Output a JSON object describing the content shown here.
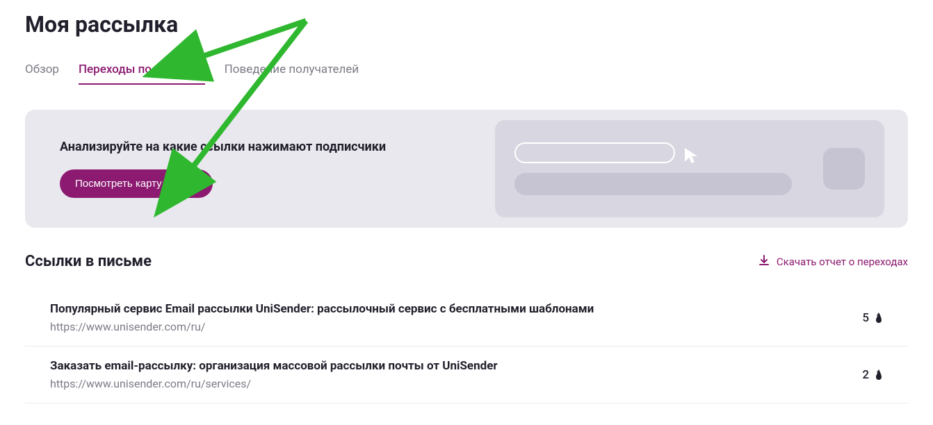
{
  "header": {
    "title": "Моя рассылка"
  },
  "tabs": [
    {
      "label": "Обзор",
      "active": false
    },
    {
      "label": "Переходы по ссылкам",
      "active": true
    },
    {
      "label": "Поведение получателей",
      "active": false
    }
  ],
  "banner": {
    "title": "Анализируйте на какие ссылки нажимают подписчики",
    "button": "Посмотреть карту кликов"
  },
  "section": {
    "title": "Ссылки в письме",
    "download": "Скачать отчет о переходах"
  },
  "links": [
    {
      "title": "Популярный сервис Email рассылки UniSender: рассылочный сервис с бесплатными шаблонами",
      "url": "https://www.unisender.com/ru/",
      "count": "5"
    },
    {
      "title": "Заказать email-рассылку: организация массовой рассылки почты от UniSender",
      "url": "https://www.unisender.com/ru/services/",
      "count": "2"
    }
  ]
}
